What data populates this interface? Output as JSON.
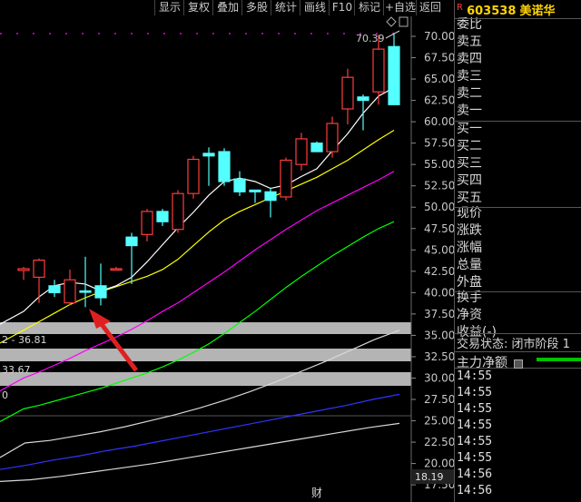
{
  "toolbar": {
    "buttons": [
      "显示",
      "复权",
      "叠加",
      "多股",
      "统计",
      "画线",
      "F10",
      "标记",
      "+自选",
      "返回"
    ]
  },
  "stock": {
    "badge": "R",
    "code": "603538",
    "name": "美诺华"
  },
  "chart": {
    "max_price_label": "70.39",
    "price_ticks": [
      "70.00",
      "67.50",
      "65.00",
      "62.50",
      "60.00",
      "57.50",
      "55.00",
      "52.50",
      "50.00",
      "47.50",
      "45.00",
      "42.50",
      "40.00",
      "37.50",
      "35.00",
      "32.50",
      "30.00",
      "27.50",
      "25.00",
      "22.50",
      "20.00",
      "17.50"
    ],
    "left_labels": [
      "2 - 36.81",
      "33.67",
      "0"
    ],
    "volume_value": "18.19",
    "bottom_label": "财",
    "colors": {
      "up": "#ff3c3c",
      "down": "#54ffff",
      "ma5": "#ffffff",
      "ma10": "#ffff00",
      "ma20": "#ff00ff",
      "ma30": "#00ff00",
      "ma60": "#3333ff",
      "arrow": "#e02020",
      "band": "#b4b4b4"
    }
  },
  "chart_data": {
    "type": "candlestick",
    "ylim": [
      17.5,
      71.5
    ],
    "candles": [
      {
        "open": 42.6,
        "high": 43.0,
        "low": 41.5,
        "close": 42.8
      },
      {
        "open": 41.8,
        "high": 44.0,
        "low": 38.8,
        "close": 43.8
      },
      {
        "open": 40.8,
        "high": 41.5,
        "low": 39.5,
        "close": 40.0
      },
      {
        "open": 38.8,
        "high": 42.7,
        "low": 38.5,
        "close": 41.5
      },
      {
        "open": 40.2,
        "high": 44.2,
        "low": 38.3,
        "close": 40.1
      },
      {
        "open": 40.8,
        "high": 43.4,
        "low": 38.5,
        "close": 39.4
      },
      {
        "open": 42.8,
        "high": 43.0,
        "low": 42.6,
        "close": 42.8
      },
      {
        "open": 46.5,
        "high": 47.0,
        "low": 41.0,
        "close": 45.5
      },
      {
        "open": 46.8,
        "high": 49.8,
        "low": 46.0,
        "close": 49.5
      },
      {
        "open": 49.5,
        "high": 49.8,
        "low": 47.8,
        "close": 48.3
      },
      {
        "open": 47.4,
        "high": 52.0,
        "low": 47.0,
        "close": 51.6
      },
      {
        "open": 51.6,
        "high": 56.0,
        "low": 51.0,
        "close": 55.6
      },
      {
        "open": 56.3,
        "high": 57.0,
        "low": 52.5,
        "close": 56.0
      },
      {
        "open": 56.5,
        "high": 56.9,
        "low": 52.5,
        "close": 53.0
      },
      {
        "open": 53.3,
        "high": 54.2,
        "low": 51.3,
        "close": 51.8
      },
      {
        "open": 52.0,
        "high": 52.0,
        "low": 50.5,
        "close": 51.8
      },
      {
        "open": 51.8,
        "high": 52.3,
        "low": 48.8,
        "close": 50.8
      },
      {
        "open": 51.2,
        "high": 55.8,
        "low": 50.8,
        "close": 55.5
      },
      {
        "open": 55.0,
        "high": 58.7,
        "low": 54.3,
        "close": 58.0
      },
      {
        "open": 57.5,
        "high": 57.7,
        "low": 56.5,
        "close": 56.5
      },
      {
        "open": 56.5,
        "high": 60.6,
        "low": 55.8,
        "close": 59.8
      },
      {
        "open": 61.5,
        "high": 66.2,
        "low": 59.7,
        "close": 65.2
      },
      {
        "open": 62.9,
        "high": 63.2,
        "low": 59.0,
        "close": 62.5
      },
      {
        "open": 63.5,
        "high": 70.2,
        "low": 62.0,
        "close": 68.5
      },
      {
        "open": 68.8,
        "high": 70.4,
        "low": 62.0,
        "close": 62.0
      }
    ],
    "ma5": [
      37.8,
      39.5,
      40.8,
      41.2,
      41.0,
      40.2,
      40.8,
      41.8,
      43.6,
      45.6,
      47.6,
      49.4,
      51.4,
      53.0,
      53.4,
      53.0,
      52.2,
      52.6,
      53.6,
      54.5,
      56.6,
      58.6,
      61.0,
      63.0,
      64.0
    ],
    "ma10": [
      35.6,
      36.6,
      37.6,
      38.6,
      39.4,
      40.1,
      40.7,
      41.3,
      41.9,
      42.7,
      43.9,
      45.5,
      47.1,
      48.5,
      49.5,
      50.3,
      51.1,
      51.9,
      52.7,
      53.5,
      54.5,
      55.5,
      56.7,
      57.9,
      59.0
    ],
    "ma20": [
      30.0,
      30.7,
      31.5,
      32.3,
      33.2,
      34.0,
      34.8,
      35.7,
      36.7,
      37.8,
      38.8,
      40.0,
      41.2,
      42.4,
      43.7,
      45.0,
      46.2,
      47.4,
      48.5,
      49.6,
      50.5,
      51.4,
      52.3,
      53.2,
      54.2
    ],
    "ma30": [
      26.4,
      26.8,
      27.3,
      27.8,
      28.3,
      28.8,
      29.4,
      30.0,
      30.6,
      31.3,
      32.1,
      33.0,
      34.0,
      35.2,
      36.5,
      37.8,
      39.2,
      40.6,
      41.9,
      43.1,
      44.3,
      45.4,
      46.5,
      47.5,
      48.3
    ],
    "lower_lines": {
      "white": [
        20.7,
        22.4,
        22.7,
        23.2,
        23.7,
        24.3,
        25.0,
        25.7,
        26.5,
        27.4,
        28.4,
        29.5,
        30.7,
        31.9,
        33.2,
        34.5,
        35.6
      ],
      "blue": [
        19.3,
        19.8,
        20.4,
        20.9,
        21.5,
        22.0,
        22.6,
        23.2,
        23.8,
        24.4,
        25.0,
        25.6,
        26.2,
        26.8,
        27.5,
        28.1
      ],
      "white2": [
        17.9,
        18.1,
        18.5,
        19.0,
        19.5,
        20.0,
        20.6,
        21.2,
        21.8,
        22.4,
        23.0,
        23.6,
        24.2,
        24.7
      ]
    }
  },
  "panel": {
    "order_rows": [
      "委比",
      "卖五",
      "卖四",
      "卖三",
      "卖二",
      "卖一",
      "买一",
      "买二",
      "买三",
      "买四",
      "买五",
      "现价",
      "涨跌",
      "涨幅",
      "总量",
      "外盘",
      "换手",
      "净资",
      "收益(-)"
    ],
    "trade_status_label": "交易状态: 闭市阶段 1",
    "main_net_label": "主力净额",
    "times": [
      "14:55",
      "14:55",
      "14:55",
      "14:55",
      "14:55",
      "14:55",
      "14:56",
      "14:56"
    ]
  }
}
